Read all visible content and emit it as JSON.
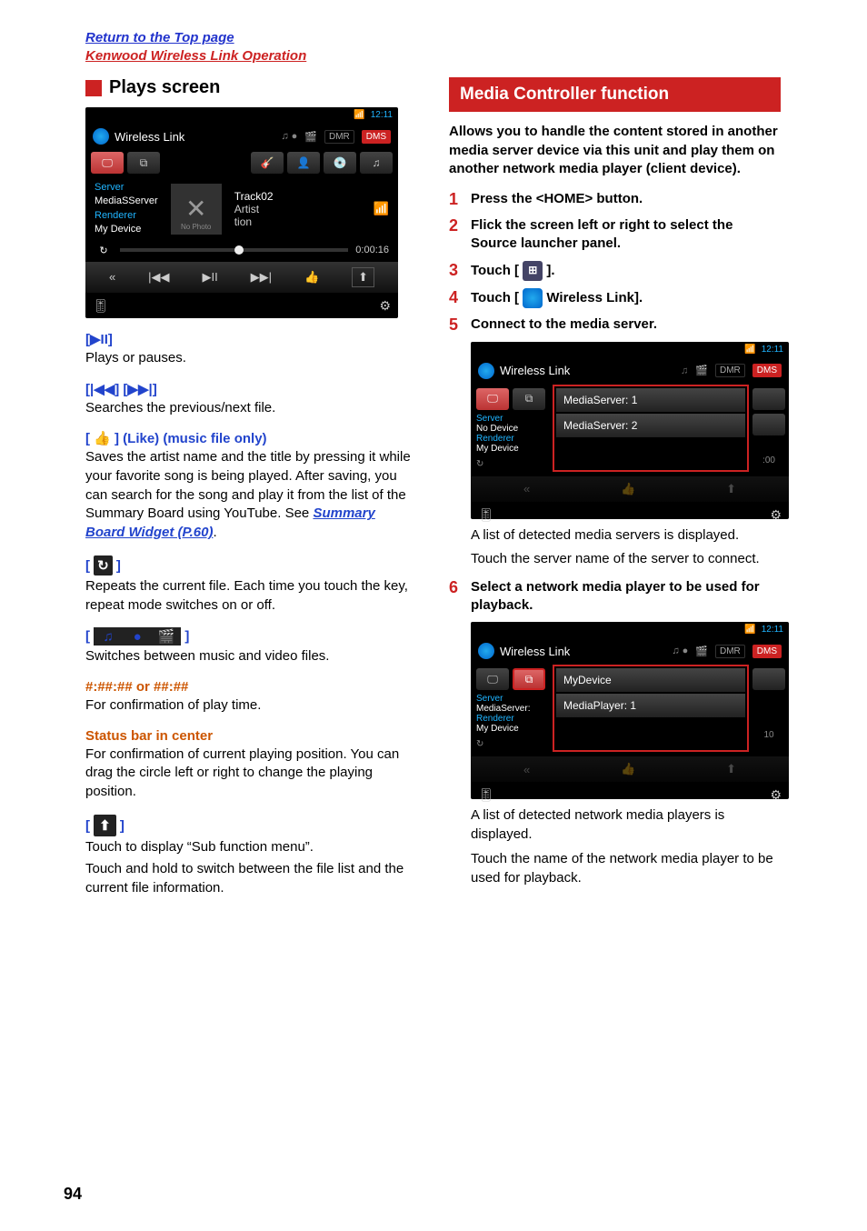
{
  "top_links": {
    "return": "Return to the Top page",
    "section": "Kenwood Wireless Link Operation"
  },
  "left": {
    "heading": "Plays screen",
    "shot": {
      "clock": "12:11",
      "title": "Wireless Link",
      "dmr": "DMR",
      "dms": "DMS",
      "sidebar": {
        "server_lbl": "Server",
        "server_val": "MediaSServer",
        "renderer_lbl": "Renderer",
        "renderer_val": "My Device"
      },
      "nophoto": "No Photo",
      "meta": {
        "track": "Track02",
        "artist": "Artist",
        "album": "tion"
      },
      "time": "0:00:16"
    },
    "defs": {
      "play_pause_h": "[▶II]",
      "play_pause_t": "Plays or pauses.",
      "seek_h": "[|◀◀] [▶▶|]",
      "seek_t": "Searches the previous/next file.",
      "like_h": "[ 👍 ] (Like) (music file only)",
      "like_t": "Saves the artist name and the title by pressing it while your favorite song is being played. After saving, you can search for the song and play it from the list of the Summary Board using YouTube. See ",
      "like_link": "Summary Board Widget (P.60)",
      "like_t_tail": ".",
      "repeat_t": "Repeats the current file. Each time you touch the key, repeat mode switches on or off.",
      "switch_t": "Switches between music and video files.",
      "time_h": "#:##:## or ##:##",
      "time_t": "For confirmation of play time.",
      "status_h": "Status bar in center",
      "status_t": "For confirmation of current playing position. You can drag the circle left or right to change the playing position.",
      "sub_t1": "Touch to display “Sub function menu”.",
      "sub_t2": "Touch and hold to switch between the file list and the current file information."
    }
  },
  "right": {
    "heading": "Media Controller function",
    "intro": "Allows you to handle the content stored in another media server device via this unit and play them on another network media player (client device).",
    "steps": {
      "s1": "Press the <HOME> button.",
      "s2": "Flick the screen left or right to select the Source launcher panel.",
      "s3a": "Touch [ ",
      "s3b": " ].",
      "s4a": "Touch [ ",
      "s4b": " Wireless Link].",
      "s5": "Connect to the media server.",
      "s5_sub1": "A list of detected media servers is displayed.",
      "s5_sub2": "Touch the server name of the server to connect.",
      "s6": "Select a network media player to be used for playback.",
      "s6_sub1": "A list of detected network media players is displayed.",
      "s6_sub2": "Touch the name of the network media player to be used for playback."
    },
    "shot2": {
      "clock": "12:11",
      "title": "Wireless Link",
      "dmr": "DMR",
      "dms": "DMS",
      "sidebar": {
        "server_lbl": "Server",
        "server_val": "No Device",
        "renderer_lbl": "Renderer",
        "renderer_val": "My Device"
      },
      "items": [
        "MediaServer: 1",
        "MediaServer: 2"
      ],
      "time_frag": ":00"
    },
    "shot3": {
      "clock": "12:11",
      "title": "Wireless Link",
      "dmr": "DMR",
      "dms": "DMS",
      "sidebar": {
        "server_lbl": "Server",
        "server_val": "MediaServer:",
        "renderer_lbl": "Renderer",
        "renderer_val": "My Device"
      },
      "items": [
        "MyDevice",
        "MediaPlayer: 1"
      ],
      "time_frag": "10"
    }
  },
  "page_number": "94"
}
